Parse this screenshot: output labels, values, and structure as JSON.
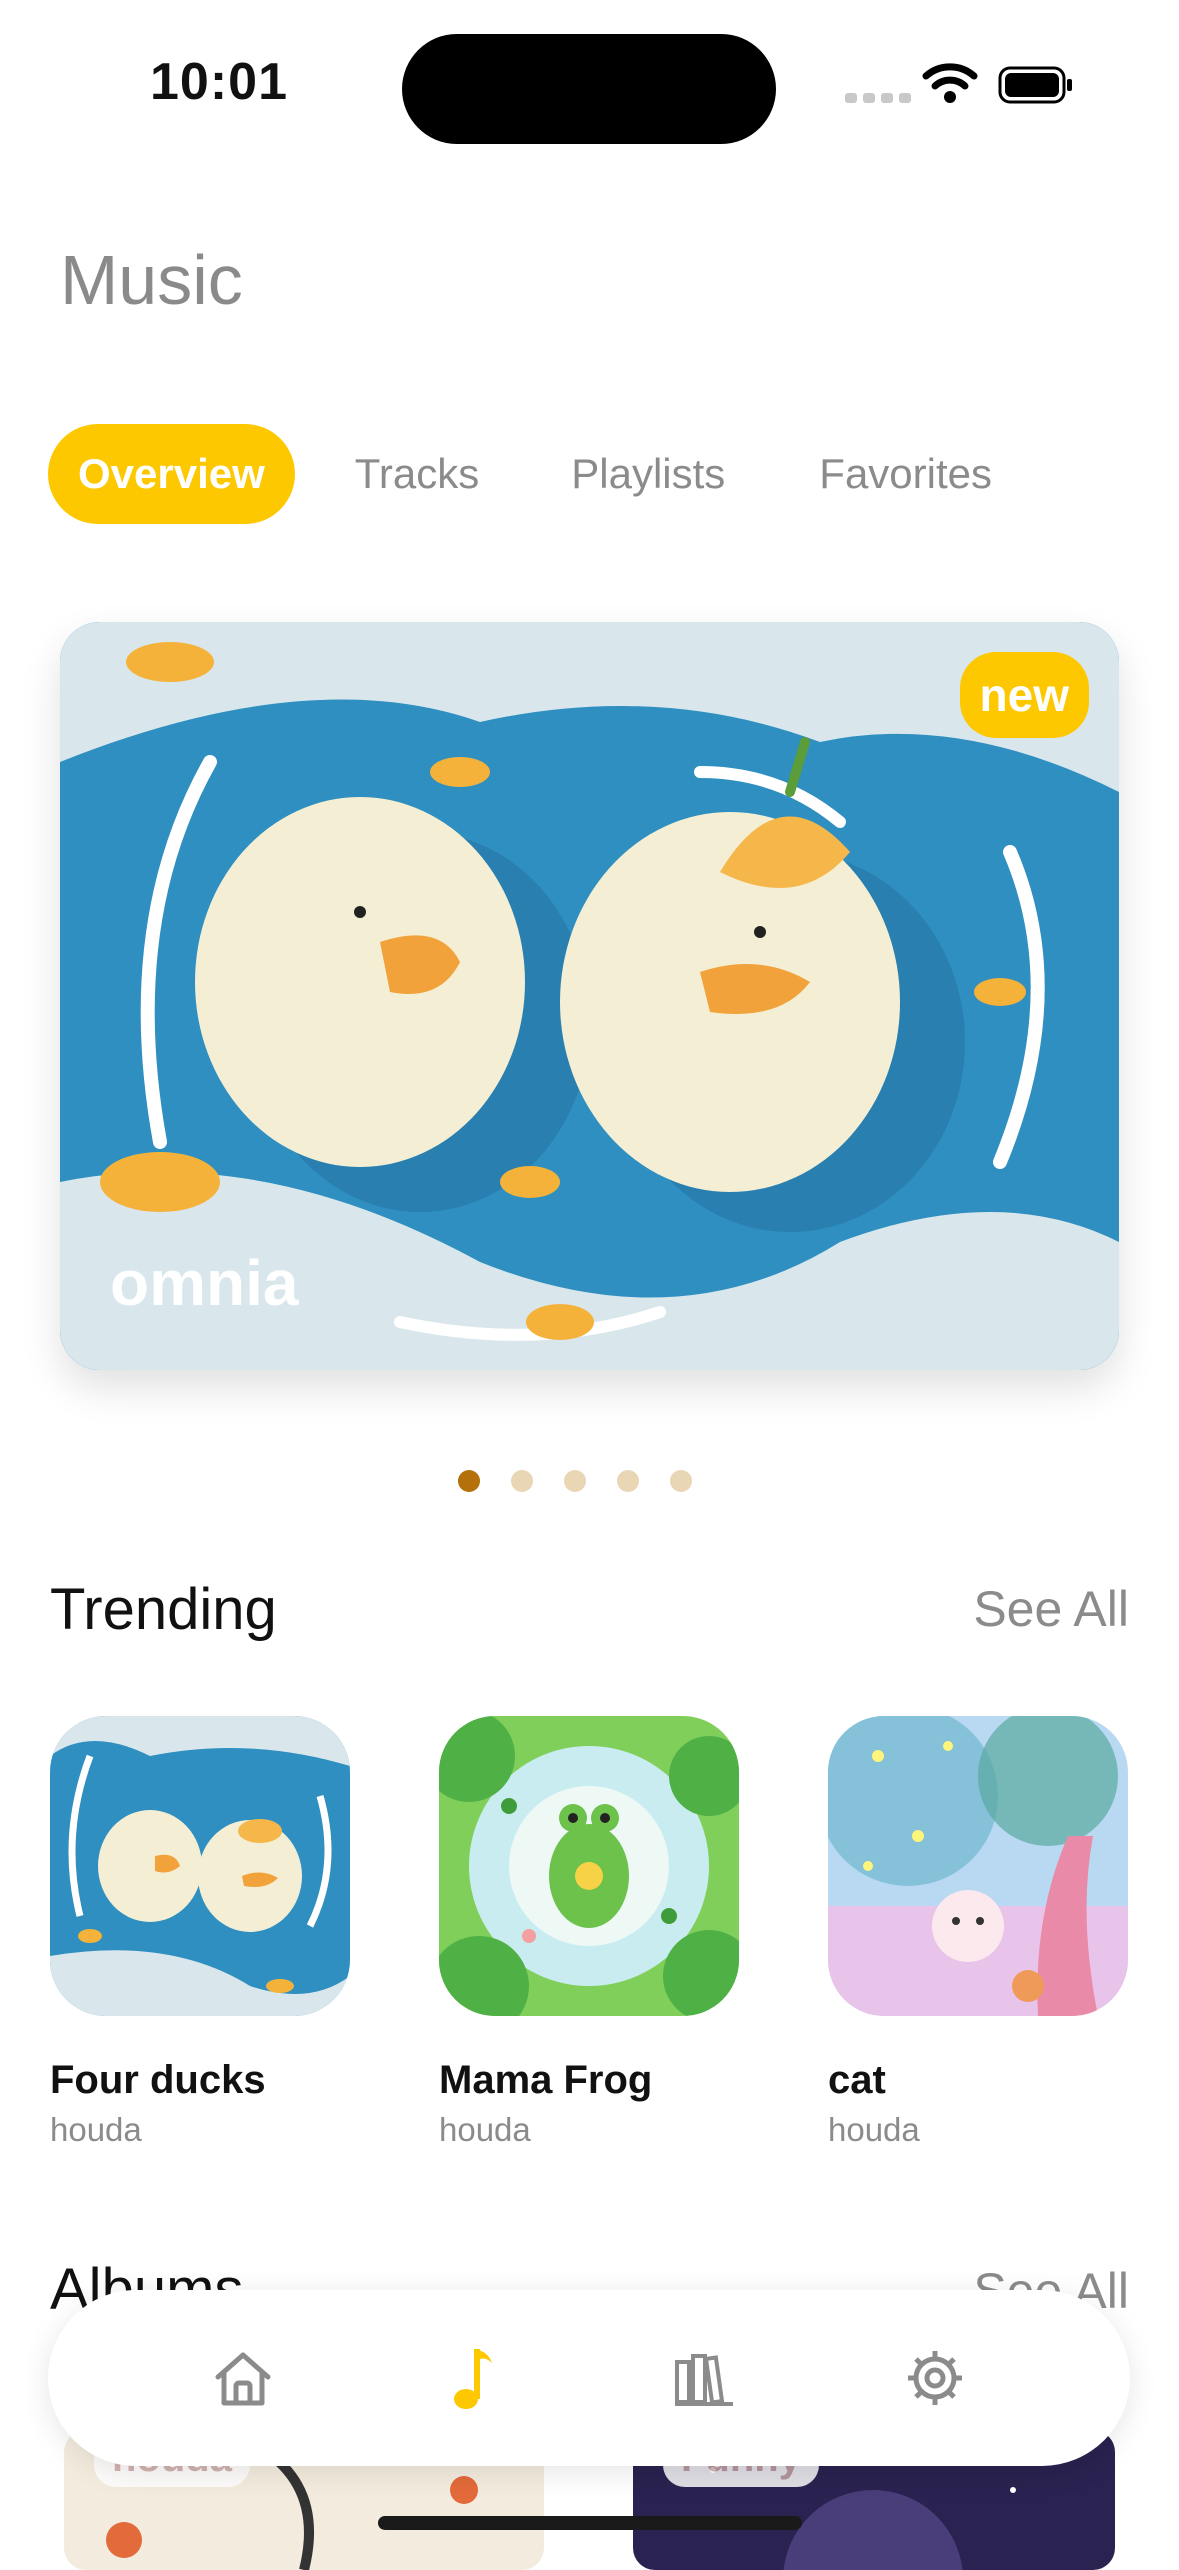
{
  "status_bar": {
    "time": "10:01"
  },
  "header": {
    "title": "Music"
  },
  "tabs": [
    {
      "label": "Overview",
      "active": true
    },
    {
      "label": "Tracks",
      "active": false
    },
    {
      "label": "Playlists",
      "active": false
    },
    {
      "label": "Favorites",
      "active": false
    }
  ],
  "hero": {
    "badge": "new",
    "caption": "omnia",
    "page_count": 5,
    "active_page": 1
  },
  "trending": {
    "title": "Trending",
    "see_all": "See All",
    "items": [
      {
        "title": "Four ducks",
        "artist": "houda"
      },
      {
        "title": "Mama Frog",
        "artist": "houda"
      },
      {
        "title": "cat",
        "artist": "houda"
      }
    ]
  },
  "albums": {
    "title": "Albums",
    "see_all": "See All",
    "items": [
      {
        "label": "houda"
      },
      {
        "label": "Funny"
      }
    ]
  },
  "bottom_nav": [
    {
      "icon": "home-icon",
      "active": false
    },
    {
      "icon": "music-note-icon",
      "active": true
    },
    {
      "icon": "library-icon",
      "active": false
    },
    {
      "icon": "gear-icon",
      "active": false
    }
  ],
  "colors": {
    "accent": "#fdc800",
    "dot_active": "#b3700b",
    "dot_inactive": "#e9d6b5",
    "muted_text": "#8b8b8b"
  }
}
